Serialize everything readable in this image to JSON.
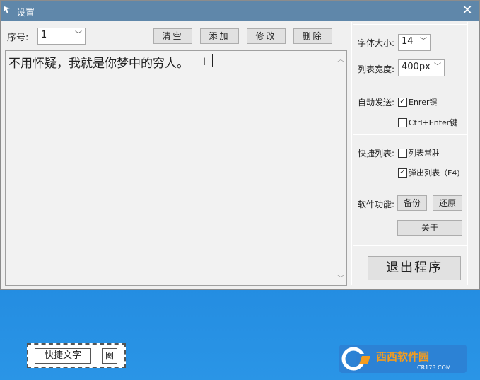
{
  "window": {
    "title": "设置",
    "close": "✕"
  },
  "toolbar": {
    "seq_label": "序号:",
    "seq_value": "1",
    "clear": "清空",
    "add": "添加",
    "edit": "修改",
    "delete": "删除"
  },
  "editor": {
    "text": "不用怀疑，我就是你梦中的穷人。"
  },
  "settings": {
    "font_size_label": "字体大小:",
    "font_size_value": "14",
    "list_width_label": "列表宽度:",
    "list_width_value": "400px",
    "autosend_label": "自动发送:",
    "enter_label": "Enrer键",
    "enter_checked": true,
    "ctrl_enter_label": "Ctrl+Enter键",
    "ctrl_enter_checked": false,
    "quicklist_label": "快捷列表:",
    "list_pin_label": "列表常驻",
    "list_pin_checked": false,
    "popup_label": "弹出列表（F4)",
    "popup_checked": true,
    "software_label": "软件功能:",
    "backup": "备份",
    "restore": "还原",
    "about": "关于",
    "exit": "退出程序"
  },
  "quickbar": {
    "quick_text": "快捷文字",
    "image": "图"
  },
  "watermark": {
    "brand": "西西软件园",
    "url": "CR173.COM"
  },
  "colors": {
    "titlebar": "#5f87aa",
    "desktop": "#1f86dd",
    "window_bg": "#f0f0f0"
  }
}
